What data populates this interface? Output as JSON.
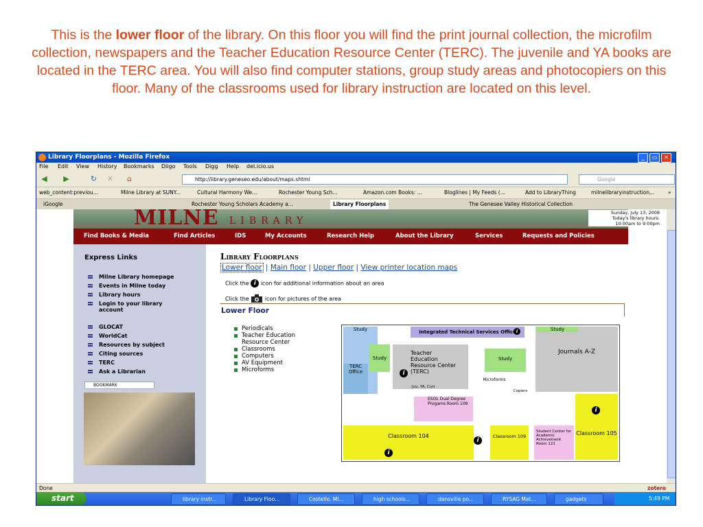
{
  "caption": {
    "part1": "This is the ",
    "bold": "lower floor",
    "part2": " of the library. On this floor you will find the print journal collection, the microfilm collection, newspapers and the Teacher Education Resource Center (TERC). The juvenile and YA books are located in the TERC area. You will also find computer stations, group study areas and photocopiers on this floor.  Many of the classrooms used for library instruction are located on this level."
  },
  "window": {
    "title": "Library Floorplans - Mozilla Firefox",
    "menu": [
      "File",
      "Edit",
      "View",
      "History",
      "Bookmarks",
      "Diigo",
      "Tools",
      "Digg",
      "Help",
      "del.icio.us"
    ],
    "url": "http://library.geneseo.edu/about/maps.shtml",
    "search_placeholder": "Google",
    "bookmarks": [
      "web_content:previou...",
      "Milne Library at SUNY...",
      "Cultural Harmony We...",
      "Rochester Young Sch...",
      "Amazon.com Books: ...",
      "Bloglines | My Feeds (...",
      "Add to LibraryThing",
      "milnelibraryinstruction...",
      "»"
    ],
    "tabs": [
      "iGoogle",
      "Rochester Young Scholars Academy a...",
      "Library Floorplans",
      "The Genesee Valley Historical Collection"
    ],
    "status": "Done",
    "status_right": "zotero"
  },
  "site": {
    "logo": "MILNE",
    "logo_sub": "LIBRARY",
    "hours_line1": "Sunday, July 13, 2008",
    "hours_line2": "Today's library hours:",
    "hours_line3": "10:00am to 9:00pm",
    "nav": [
      "Find Books  & Media",
      "Find Articles",
      "IDS",
      "My Accounts",
      "Research Help",
      "About the Library",
      "Services",
      "Requests and Policies"
    ],
    "express_title": "Express Links",
    "express_links_1": [
      "Milne Library homepage",
      "Events in Milne today",
      "Library hours",
      "Login to your library account"
    ],
    "express_links_2": [
      "GLOCAT",
      "WorldCat",
      "Resources by subject",
      "Citing sources",
      "TERC",
      "Ask a Librarian"
    ],
    "bookmark_label": "BOOKMARK"
  },
  "page": {
    "title": "Library Floorplans",
    "links": [
      "Lower floor",
      "Main floor",
      "Upper floor",
      "View printer location maps"
    ],
    "separator": "|",
    "info_pre": "Click the",
    "info_post1": "icon for additional information about an area",
    "info_post2": "icon for pictures of the area",
    "section_title": "Lower Floor",
    "floor_items": [
      "Periodicals",
      "Teacher Education Resource Center",
      "Classrooms",
      "Computers",
      "AV Equipment",
      "Microforms"
    ]
  },
  "floorplan": {
    "study1": "Study",
    "its": "Integrated Technical Services Office",
    "study2": "Study",
    "journals": "Journals A-Z",
    "study3": "Study",
    "terc": "Teacher Education Resource Center (TERC)",
    "terc_sub": "Juv, YA, Curr",
    "terc_office": "TERC Office",
    "study4": "Study",
    "microforms": "Microforms",
    "copiers": "Copiers",
    "esol": "ESOL Dual Degree Progams Room 108",
    "classroom104": "Classroom 104",
    "classroom109": "Classroom 109",
    "student_center": "Student Center for Academic Achievement Room 121",
    "classroom105": "Classroom 105"
  },
  "taskbar": {
    "start": "start",
    "tasks": [
      "library instr...",
      "Library Floo...",
      "Costello, Mi...",
      "high schools...",
      "dansville po...",
      "RYSAG Mat...",
      "gadgets"
    ],
    "clock": "5:49 PM"
  }
}
